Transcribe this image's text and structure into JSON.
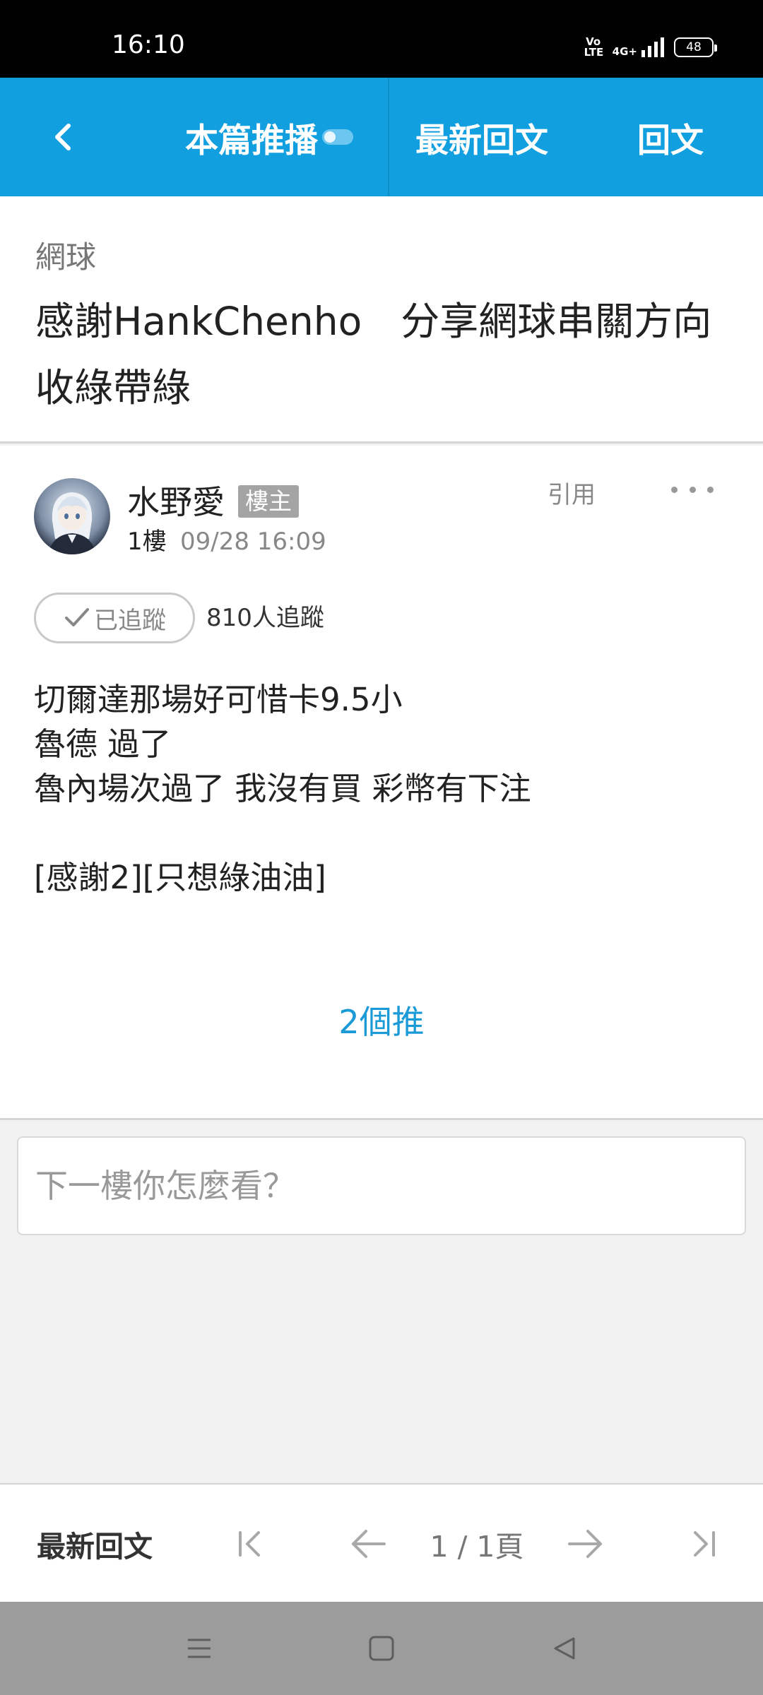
{
  "status_bar": {
    "time": "16:10",
    "volte": "Vo LTE",
    "network": "4G+",
    "battery": "48"
  },
  "header": {
    "push_tab": "本篇推播",
    "latest_tab": "最新回文",
    "reply_tab": "回文",
    "background_color": "#129fe0"
  },
  "topic": {
    "category": "網球",
    "title": "感謝HankChenho　分享網球串關方向收綠帶綠"
  },
  "post": {
    "author": "水野愛",
    "badge": "樓主",
    "floor": "1樓",
    "time": "09/28 16:09",
    "quote_label": "引用",
    "follow_label": "已追蹤",
    "follow_count": "810人追蹤",
    "body_lines": [
      "切爾達那場好可惜卡9.5小",
      "魯德 過了",
      "魯內場次過了 我沒有買 彩幣有下注",
      "",
      "[感謝2][只想綠油油]"
    ],
    "push_count": "2個推"
  },
  "reply_box": {
    "placeholder": "下一樓你怎麼看？"
  },
  "pagination": {
    "latest_label": "最新回文",
    "page_info": "1 / 1頁"
  },
  "icons": {
    "back": "chevron-left-icon",
    "more": "more-dots-icon",
    "check": "check-icon",
    "first": "first-page-icon",
    "prev": "arrow-left-icon",
    "next": "arrow-right-icon",
    "last": "last-page-icon",
    "nav_menu": "menu-icon",
    "nav_home": "home-icon",
    "nav_back": "back-triangle-icon"
  }
}
